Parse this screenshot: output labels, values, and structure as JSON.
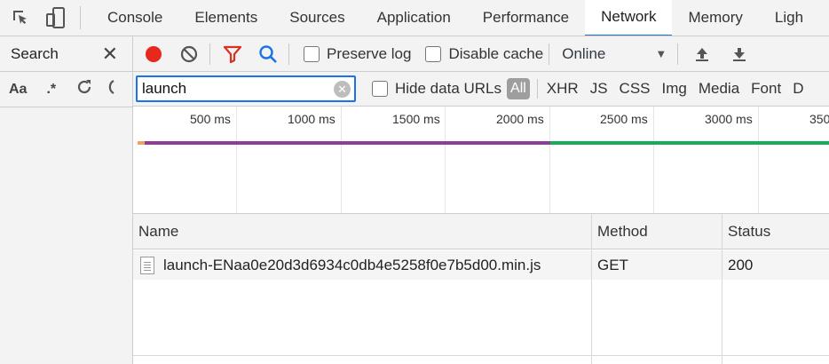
{
  "devtools_tabs": [
    {
      "label": "Console"
    },
    {
      "label": "Elements"
    },
    {
      "label": "Sources"
    },
    {
      "label": "Application"
    },
    {
      "label": "Performance"
    },
    {
      "label": "Network",
      "active": true
    },
    {
      "label": "Memory"
    },
    {
      "label": "Ligh"
    }
  ],
  "search_panel": {
    "title": "Search",
    "match_case_label": "Aa",
    "regex_label": ".*"
  },
  "toolbar": {
    "preserve_log_label": "Preserve log",
    "preserve_log_checked": false,
    "disable_cache_label": "Disable cache",
    "disable_cache_checked": false,
    "throttling_value": "Online"
  },
  "filter": {
    "value": "launch",
    "hide_data_urls_label": "Hide data URLs",
    "hide_data_urls_checked": false,
    "types": [
      "All",
      "XHR",
      "JS",
      "CSS",
      "Img",
      "Media",
      "Font",
      "D"
    ],
    "active_type": "All"
  },
  "overview": {
    "ticks": [
      "500 ms",
      "1000 ms",
      "1500 ms",
      "2000 ms",
      "2500 ms",
      "3000 ms",
      "350"
    ]
  },
  "table": {
    "columns": [
      "Name",
      "Method",
      "Status"
    ],
    "rows": [
      {
        "name": "launch-ENaa0e20d3d6934c0db4e5258f0e7b5d00.min.js",
        "method": "GET",
        "status": "200"
      }
    ]
  },
  "colors": {
    "record": "#e8271d",
    "filter_funnel": "#d93025",
    "search_icon": "#1a73e8",
    "accent": "#1a73e8",
    "timeline_orange": "#f0a35a",
    "timeline_purple": "#8e3d9b",
    "timeline_green": "#1aab56"
  }
}
